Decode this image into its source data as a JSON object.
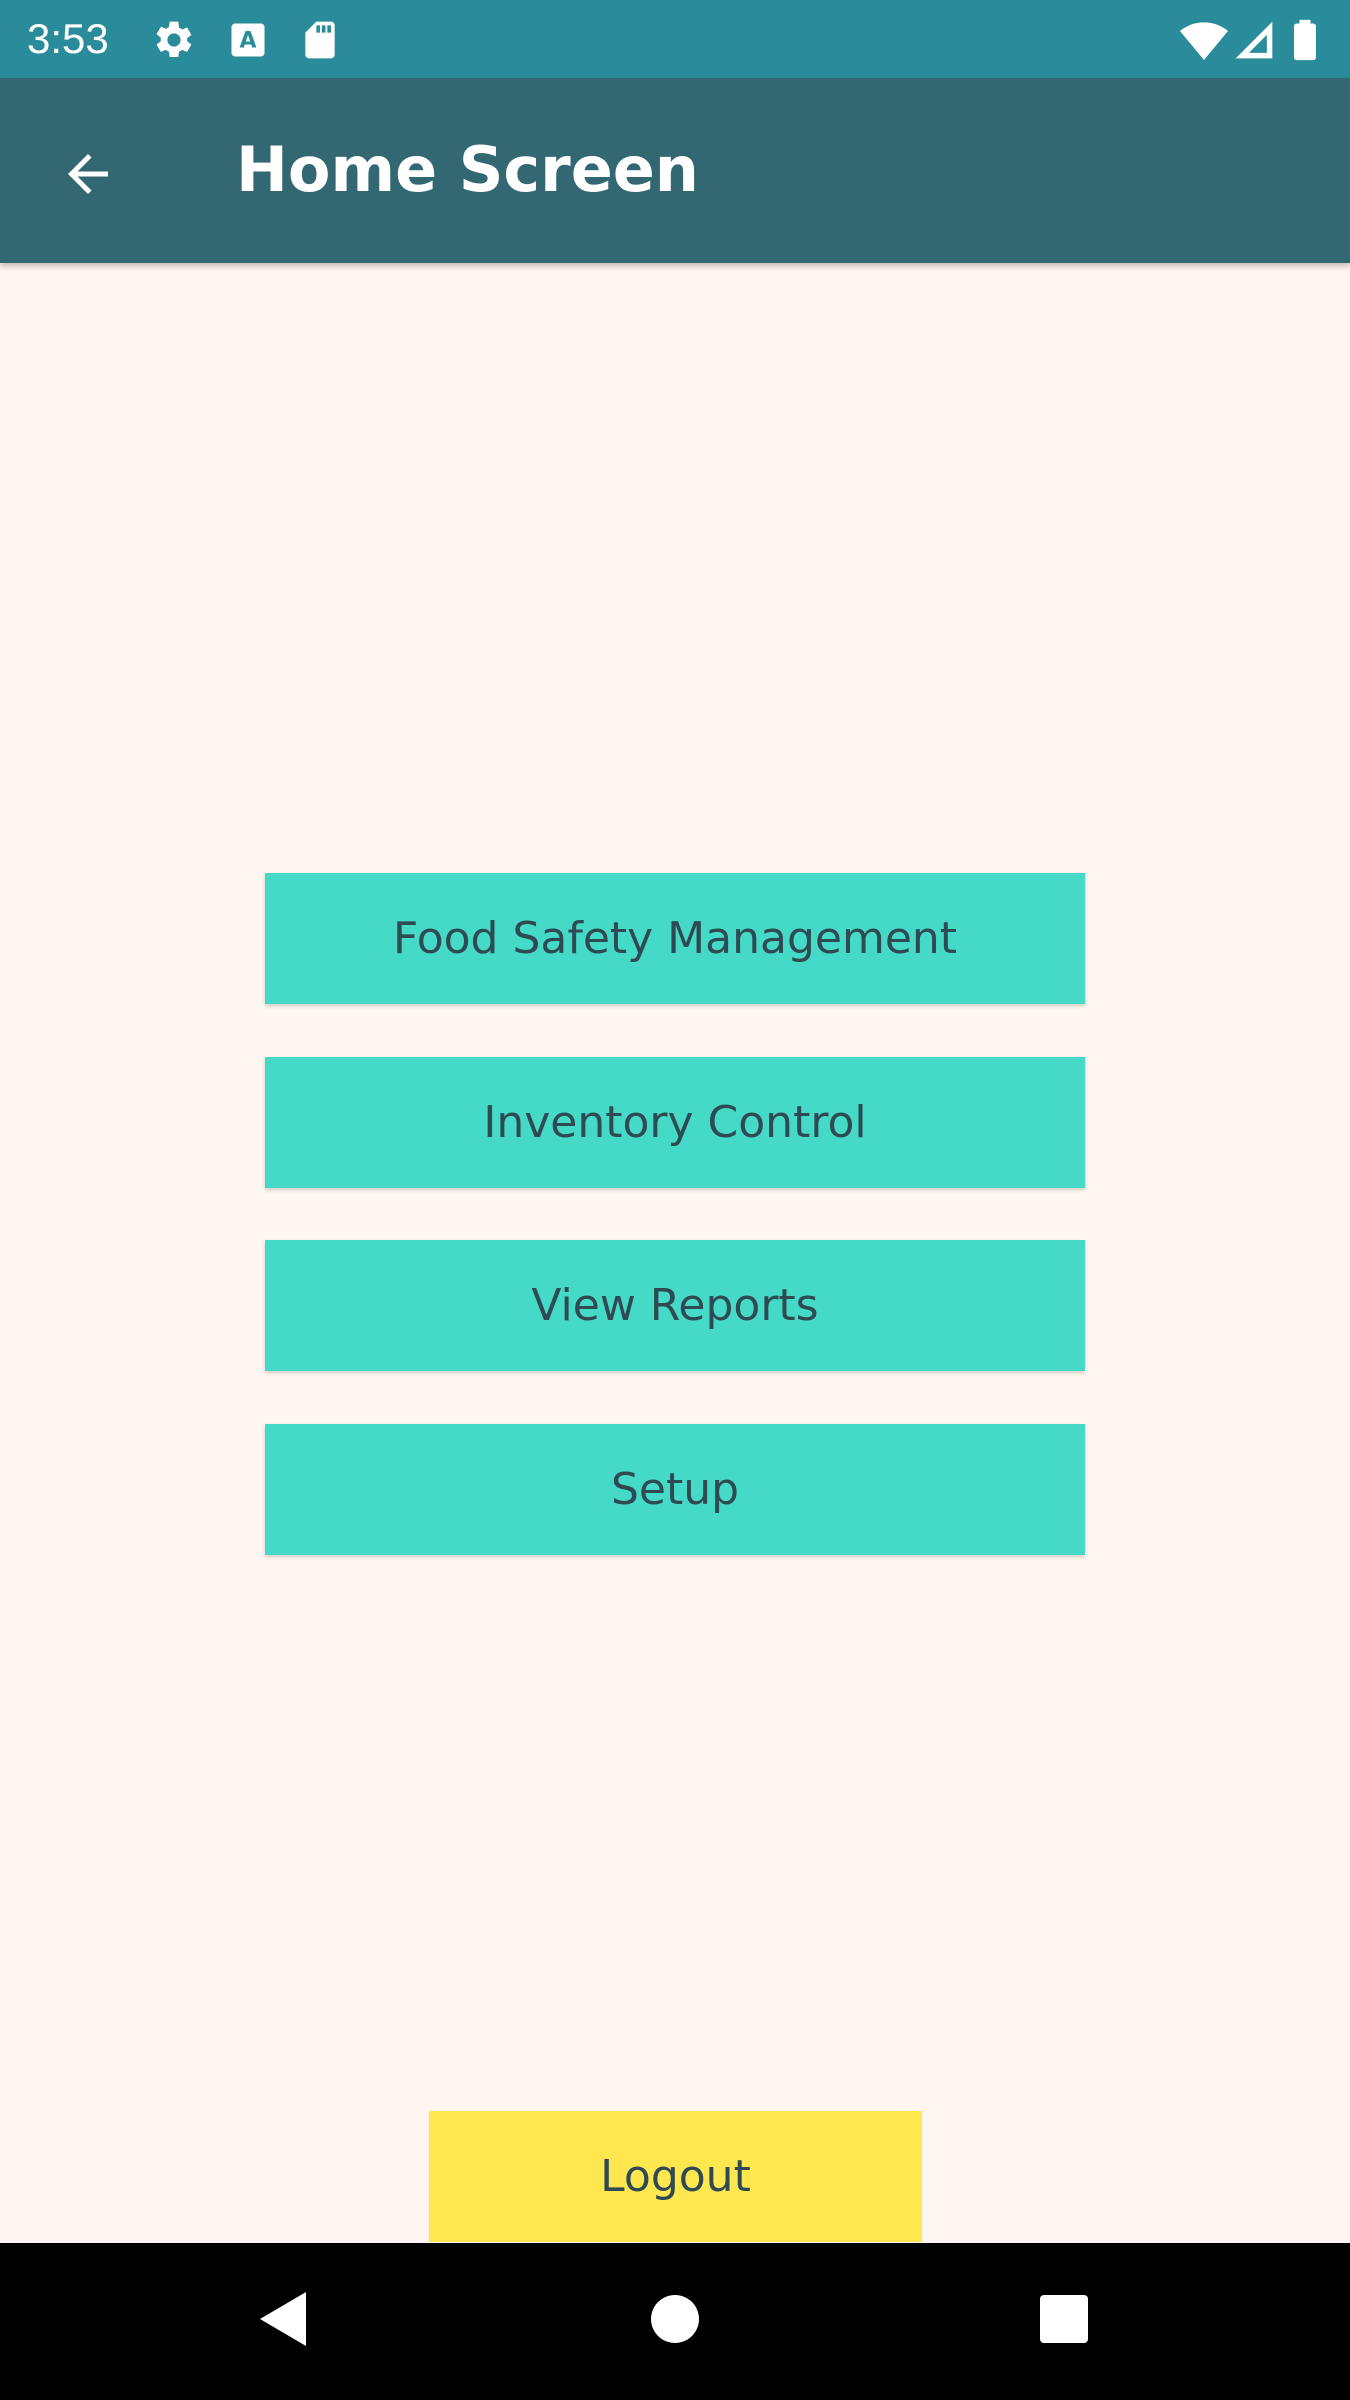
{
  "status_bar": {
    "time": "3:53",
    "icons": [
      "settings-icon",
      "a-badge-icon",
      "sd-card-icon",
      "wifi-icon",
      "signal-icon",
      "battery-icon"
    ]
  },
  "app_bar": {
    "back_icon": "arrow-back-icon",
    "title": "Home Screen"
  },
  "menu": {
    "items": [
      {
        "label": "Food Safety Management"
      },
      {
        "label": "Inventory Control"
      },
      {
        "label": "View Reports"
      },
      {
        "label": "Setup"
      }
    ]
  },
  "logout": {
    "label": "Logout"
  },
  "nav_bar": {
    "icons": [
      "back-triangle-icon",
      "home-circle-icon",
      "recents-square-icon"
    ]
  },
  "colors": {
    "status_bar": "#2A8C9A",
    "app_bar": "#336873",
    "background": "#FFF6F1",
    "menu_button": "#45D9C7",
    "logout_button": "#FFE74F",
    "button_text": "#2F4A52"
  }
}
